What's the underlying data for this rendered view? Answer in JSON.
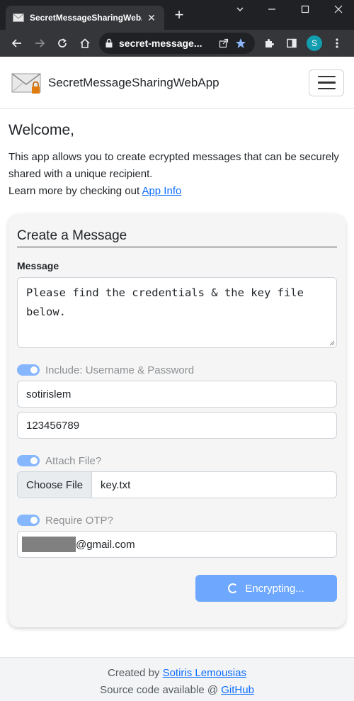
{
  "browser": {
    "tab_title": "SecretMessageSharingWeb/",
    "new_tab": "+",
    "url": "secret-message...",
    "profile_initial": "S"
  },
  "navbar": {
    "brand": "SecretMessageSharingWebApp"
  },
  "intro": {
    "heading": "Welcome,",
    "line1": "This app allows you to create ecrypted messages that can be securely shared with a unique recipient.",
    "line2_prefix": "Learn more by checking out ",
    "line2_link": "App Info"
  },
  "form": {
    "title": "Create a Message",
    "message_label": "Message",
    "message_value": "Please find the credentials & the key file below.",
    "credentials_toggle": "Include: Username & Password",
    "username": "sotirislem",
    "password": "123456789",
    "file_toggle": "Attach File?",
    "choose_file": "Choose File",
    "file_name": "key.txt",
    "otp_toggle": "Require OTP?",
    "email_suffix": "@gmail.com",
    "submit": "Encrypting..."
  },
  "footer": {
    "created_prefix": "Created by ",
    "author": "Sotiris Lemousias",
    "source_prefix": "Source code available @ ",
    "source_link": "GitHub"
  },
  "colors": {
    "accent": "#0d6efd",
    "toggle": "#86b7fe",
    "submit": "#6ea8fe"
  }
}
